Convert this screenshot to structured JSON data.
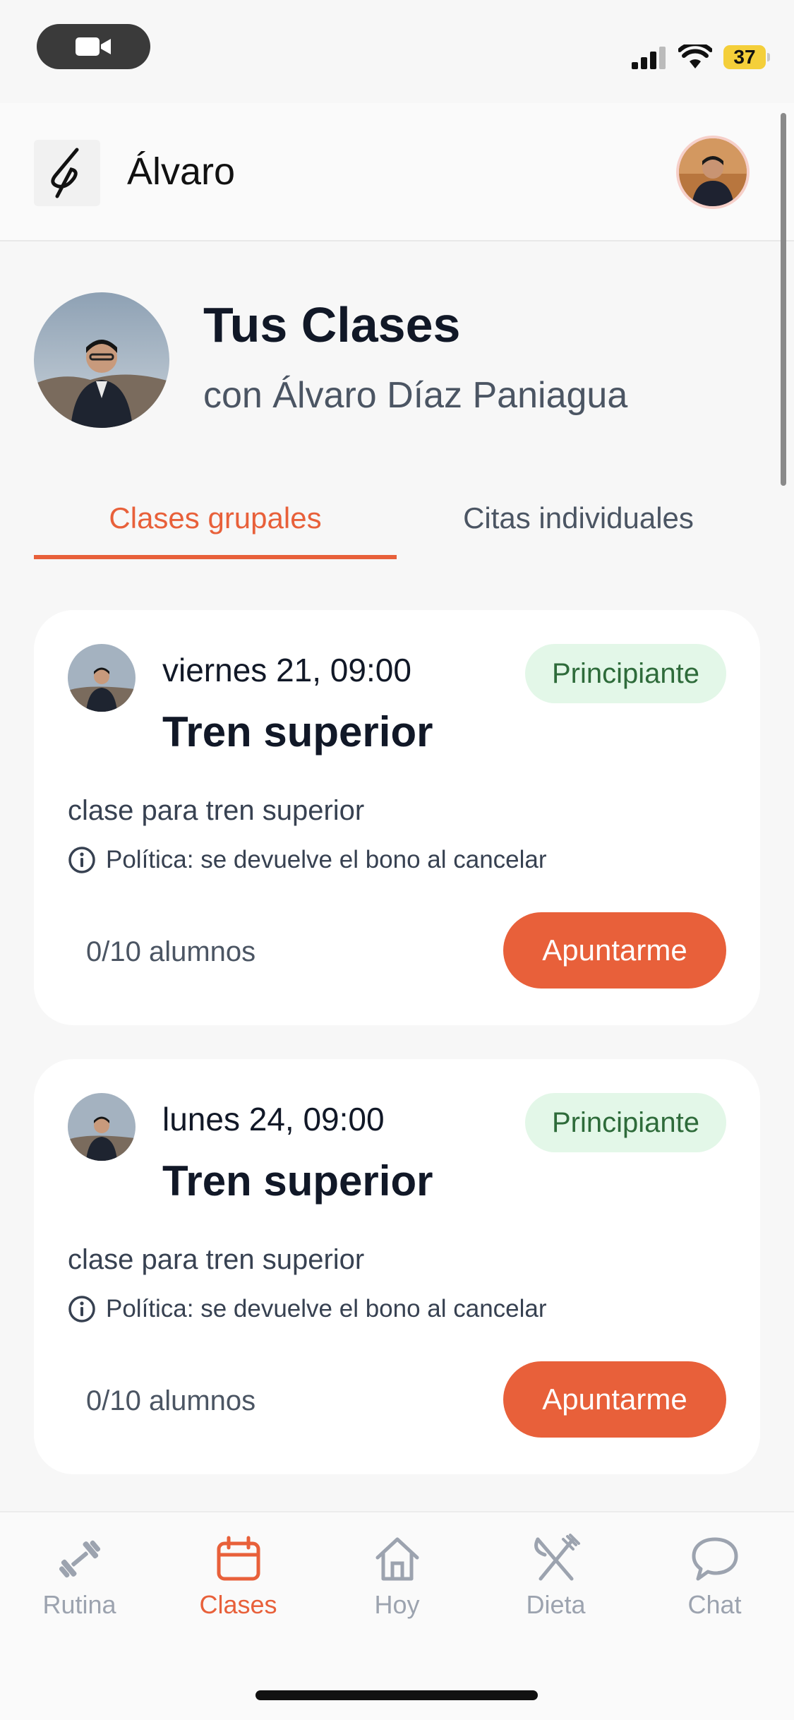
{
  "status_bar": {
    "battery": "37"
  },
  "header": {
    "title": "Álvaro"
  },
  "hero": {
    "title": "Tus Clases",
    "subtitle": "con Álvaro Díaz Paniagua"
  },
  "tabs": [
    {
      "label": "Clases grupales",
      "active": true
    },
    {
      "label": "Citas individuales",
      "active": false
    }
  ],
  "classes": [
    {
      "date": "viernes 21, 09:00",
      "name": "Tren superior",
      "level": "Principiante",
      "description": "clase para tren superior",
      "policy": "Política: se devuelve el bono al cancelar",
      "students": "0/10 alumnos",
      "action": "Apuntarme"
    },
    {
      "date": "lunes 24, 09:00",
      "name": "Tren superior",
      "level": "Principiante",
      "description": "clase para tren superior",
      "policy": "Política: se devuelve el bono al cancelar",
      "students": "0/10 alumnos",
      "action": "Apuntarme"
    }
  ],
  "bottom_nav": [
    {
      "label": "Rutina",
      "icon": "dumbbell-icon",
      "active": false
    },
    {
      "label": "Clases",
      "icon": "calendar-icon",
      "active": true
    },
    {
      "label": "Hoy",
      "icon": "home-icon",
      "active": false
    },
    {
      "label": "Dieta",
      "icon": "utensils-icon",
      "active": false
    },
    {
      "label": "Chat",
      "icon": "chat-icon",
      "active": false
    }
  ],
  "colors": {
    "accent": "#e8603a",
    "badge_bg": "#e3f7e8",
    "badge_text": "#2e6b3a",
    "inactive": "#9ca3af"
  }
}
